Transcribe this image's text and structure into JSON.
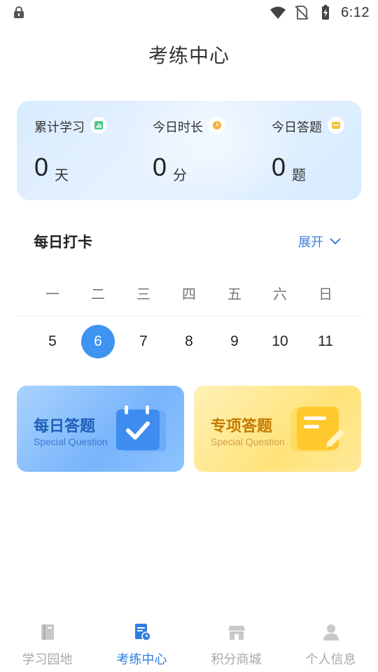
{
  "status_bar": {
    "time": "6:12",
    "icons": [
      "lock-icon",
      "wifi-icon",
      "no-sim-icon",
      "battery-charging-icon"
    ]
  },
  "page": {
    "title": "考练中心"
  },
  "stats": [
    {
      "label": "累计学习",
      "value": "0",
      "unit": "天",
      "icon": "chart-icon",
      "icon_color": "#4cc98a"
    },
    {
      "label": "今日时长",
      "value": "0",
      "unit": "分",
      "icon": "clock-icon",
      "icon_color": "#f4b23a"
    },
    {
      "label": "今日答题",
      "value": "0",
      "unit": "题",
      "icon": "card-icon",
      "icon_color": "#f2c33c"
    }
  ],
  "checkin": {
    "title": "每日打卡",
    "expand_label": "展开",
    "weekdays": [
      "一",
      "二",
      "三",
      "四",
      "五",
      "六",
      "日"
    ],
    "dates": [
      "5",
      "6",
      "7",
      "8",
      "9",
      "10",
      "11"
    ],
    "selected_date": "6"
  },
  "quiz_cards": [
    {
      "title": "每日答题",
      "subtitle": "Special Question",
      "icon": "calendar-check-icon"
    },
    {
      "title": "专项答题",
      "subtitle": "Special Question",
      "icon": "note-edit-icon"
    }
  ],
  "bottom_nav": [
    {
      "label": "学习园地",
      "icon": "book-icon",
      "active": false
    },
    {
      "label": "考练中心",
      "icon": "exam-icon",
      "active": true
    },
    {
      "label": "积分商城",
      "icon": "shop-icon",
      "active": false
    },
    {
      "label": "个人信息",
      "icon": "person-icon",
      "active": false
    }
  ],
  "colors": {
    "accent": "#3f93f1",
    "active_nav": "#2f7de1",
    "inactive_nav": "#a8a8a8"
  }
}
